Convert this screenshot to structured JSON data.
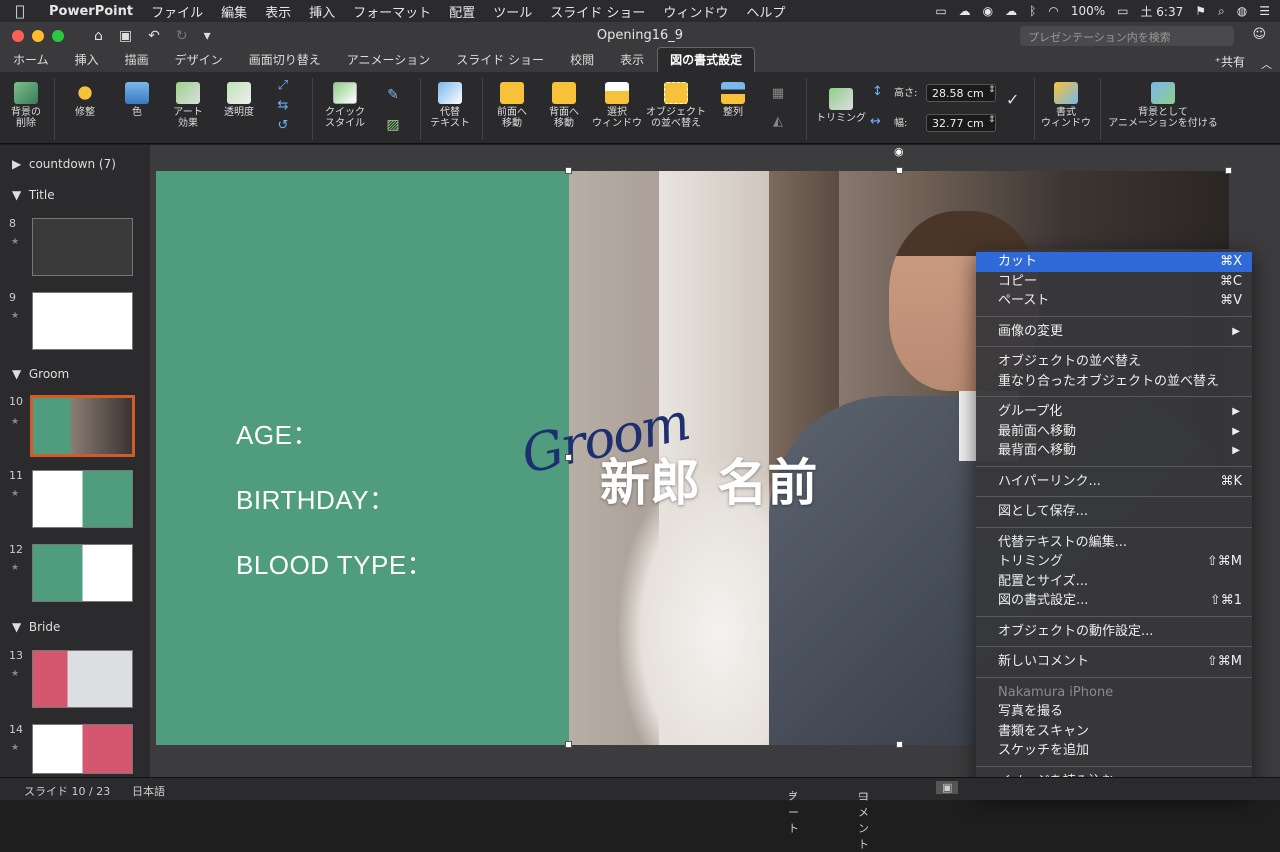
{
  "menubar": {
    "items": [
      "PowerPoint",
      "ファイル",
      "編集",
      "表示",
      "挿入",
      "フォーマット",
      "配置",
      "ツール",
      "スライド ショー",
      "ウィンドウ",
      "ヘルプ"
    ],
    "battery": "100%",
    "clock": "土 6:37"
  },
  "window": {
    "title": "Opening16_9",
    "search_placeholder": "プレゼンテーション内を検索"
  },
  "tabs": [
    "ホーム",
    "挿入",
    "描画",
    "デザイン",
    "画面切り替え",
    "アニメーション",
    "スライド ショー",
    "校閲",
    "表示",
    "図の書式設定"
  ],
  "active_tab": "図の書式設定",
  "share_label": "共有",
  "ribbon": {
    "remove_bg": [
      "背景の",
      "削除"
    ],
    "corrections": "修整",
    "color": "色",
    "art_effects": [
      "アート",
      "効果"
    ],
    "transparency": "透明度",
    "quick_styles": [
      "クイック",
      "スタイル"
    ],
    "alt_text": [
      "代替",
      "テキスト"
    ],
    "bring_forward": [
      "前面へ",
      "移動"
    ],
    "send_backward": [
      "背面へ",
      "移動"
    ],
    "selection_pane": [
      "選択",
      "ウィンドウ"
    ],
    "arrange_objects": [
      "オブジェクト",
      "の並べ替え"
    ],
    "align": "整列",
    "crop": "トリミング",
    "height_label": "高さ:",
    "height_value": "28.58 cm",
    "width_label": "幅:",
    "width_value": "32.77 cm",
    "format_pane": [
      "書式",
      "ウィンドウ"
    ],
    "animate_as_bg": [
      "背景として",
      "アニメーションを付ける"
    ]
  },
  "sidebar": {
    "sections": [
      "countdown (7)",
      "Title",
      "Groom",
      "Bride"
    ],
    "slide_numbers": [
      "8",
      "9",
      "10",
      "11",
      "12",
      "13",
      "14"
    ]
  },
  "slide": {
    "age": "AGE：",
    "birthday": "BIRTHDAY：",
    "blood_type": "BLOOD TYPE：",
    "script": "Groom",
    "name": "新郎 名前"
  },
  "context_menu": {
    "items": [
      {
        "label": "カット",
        "shortcut": "⌘X"
      },
      {
        "label": "コピー",
        "shortcut": "⌘C"
      },
      {
        "label": "ペースト",
        "shortcut": "⌘V"
      },
      {
        "label": "画像の変更"
      },
      {
        "label": "オブジェクトの並べ替え"
      },
      {
        "label": "重なり合ったオブジェクトの並べ替え"
      },
      {
        "label": "グループ化"
      },
      {
        "label": "最前面へ移動"
      },
      {
        "label": "最背面へ移動"
      },
      {
        "label": "ハイパーリンク...",
        "shortcut": "⌘K"
      },
      {
        "label": "図として保存..."
      },
      {
        "label": "代替テキストの編集..."
      },
      {
        "label": "トリミング",
        "shortcut": "⇧⌘M"
      },
      {
        "label": "配置とサイズ..."
      },
      {
        "label": "図の書式設定...",
        "shortcut": "⇧⌘1"
      },
      {
        "label": "オブジェクトの動作設定..."
      },
      {
        "label": "新しいコメント",
        "shortcut": "⇧⌘M"
      },
      {
        "label": "Nakamura iPhone"
      },
      {
        "label": "写真を撮る"
      },
      {
        "label": "書類をスキャン"
      },
      {
        "label": "スケッチを追加"
      },
      {
        "label": "イメージを読み込む"
      }
    ]
  },
  "status": {
    "slide_info": "スライド 10 / 23",
    "language": "日本語",
    "notes": "ノート",
    "comments": "コメント"
  },
  "colors": {
    "slide_green": "#4f9d7e",
    "selection": "#d45a2a",
    "menu_highlight": "#2f6ad8"
  }
}
